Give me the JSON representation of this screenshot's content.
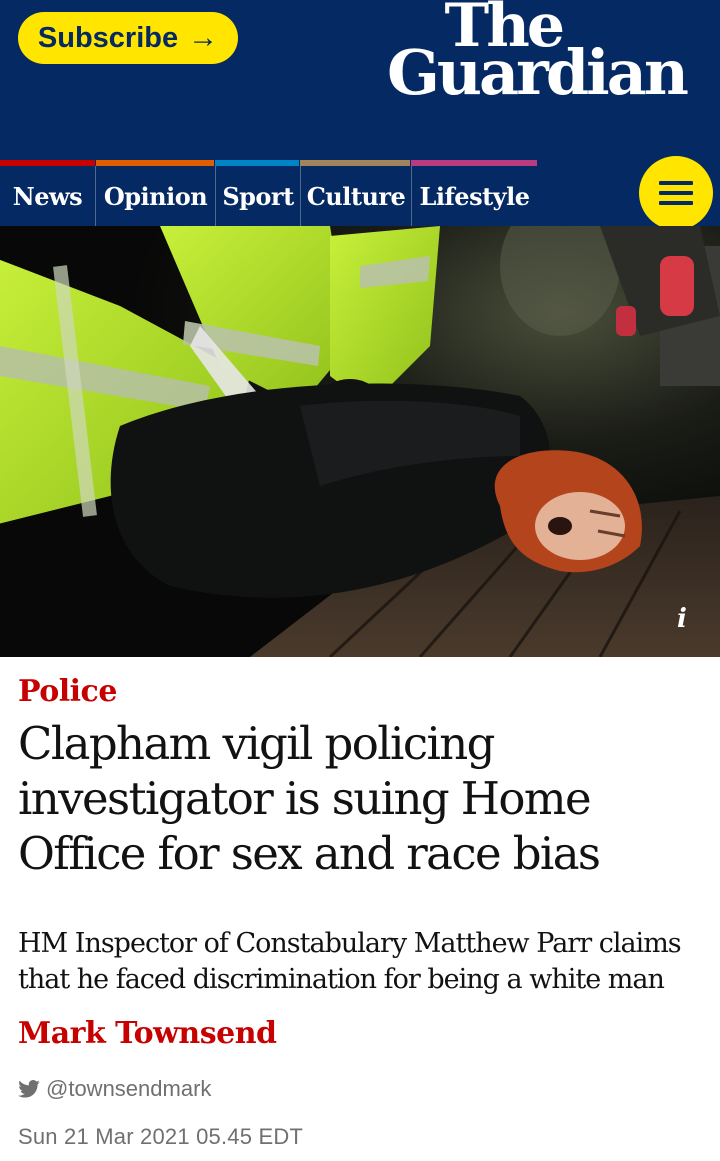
{
  "header": {
    "subscribe_label": "Subscribe",
    "logo_line1": "The",
    "logo_line2": "Guardian",
    "brand_color": "#052962",
    "accent_color": "#ffe500"
  },
  "nav": {
    "pillars": [
      {
        "label": "News",
        "color": "#c70000"
      },
      {
        "label": "Opinion",
        "color": "#e05e00"
      },
      {
        "label": "Sport",
        "color": "#0084c6"
      },
      {
        "label": "Culture",
        "color": "#a1845c"
      },
      {
        "label": "Lifestyle",
        "color": "#bb3b80"
      }
    ],
    "menu_icon": "hamburger-menu-icon"
  },
  "hero": {
    "alt": "Police officers in high-visibility jackets restraining a woman with red hair on the ground at night",
    "info_icon": "info-icon"
  },
  "article": {
    "kicker": "Police",
    "headline": "Clapham vigil policing investigator is suing Home Office for sex and race bias",
    "standfirst": "HM Inspector of Constabulary Matthew Parr claims that he faced discrimination for being a white man",
    "byline": "Mark Townsend",
    "twitter_handle": "@townsendmark",
    "date": "Sun 21 Mar 2021 05.45 EDT",
    "kicker_color": "#c70000"
  }
}
